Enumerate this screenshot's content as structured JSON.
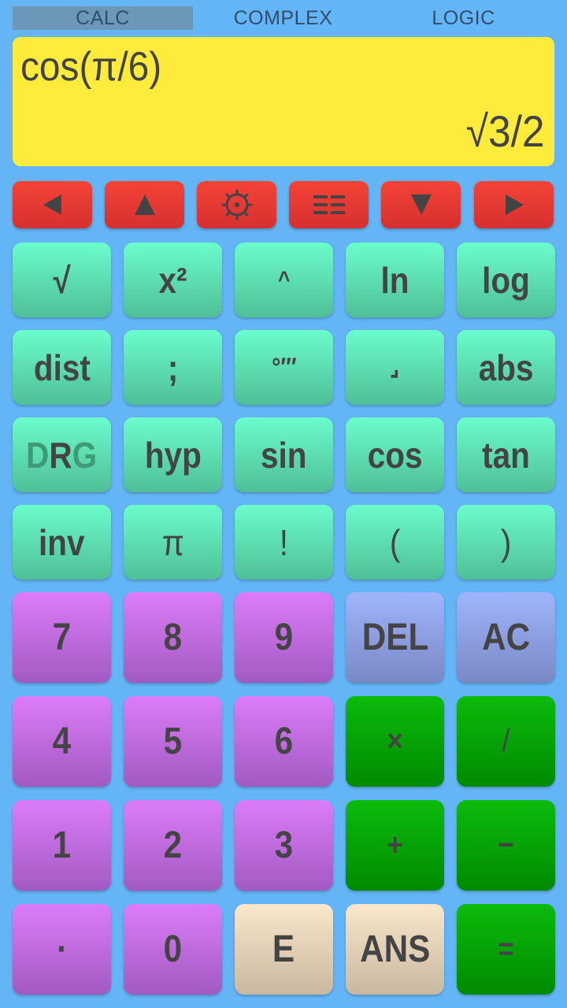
{
  "tabs": [
    {
      "label": "CALC",
      "active": true
    },
    {
      "label": "COMPLEX",
      "active": false
    },
    {
      "label": "LOGIC",
      "active": false
    }
  ],
  "display": {
    "expression": "cos(π/6)",
    "result": "√3/2"
  },
  "nav_buttons": [
    {
      "icon": "arrow-left-icon",
      "label": "cursor left"
    },
    {
      "icon": "arrow-up-icon",
      "label": "history up"
    },
    {
      "icon": "settings-icon",
      "label": "settings"
    },
    {
      "icon": "menu-icon",
      "label": "menu"
    },
    {
      "icon": "arrow-down-icon",
      "label": "history down"
    },
    {
      "icon": "arrow-right-icon",
      "label": "cursor right"
    }
  ],
  "function_keys": [
    [
      "√",
      "x²",
      "^",
      "ln",
      "log"
    ],
    [
      "dist",
      ";",
      "°′″",
      "⌟",
      "abs"
    ],
    [
      "DRG",
      "hyp",
      "sin",
      "cos",
      "tan"
    ],
    [
      "inv",
      "π",
      "!",
      "(",
      ")"
    ]
  ],
  "drg": {
    "d": "D",
    "r": "R",
    "g": "G",
    "active_mode": "R"
  },
  "main_keys": [
    [
      "7",
      "8",
      "9",
      "DEL",
      "AC"
    ],
    [
      "4",
      "5",
      "6",
      "×",
      "/"
    ],
    [
      "1",
      "2",
      "3",
      "+",
      "−"
    ],
    [
      "·",
      "0",
      "E",
      "ANS",
      "="
    ]
  ],
  "colors": {
    "background": "#64b5f6",
    "display": "#ffeb3b",
    "nav": "#f44336",
    "function": "#6bfccc",
    "digit": "#dc7cf8",
    "clear": "#9fb4fc",
    "operator": "#0bbb0b",
    "special": "#fae7cb"
  }
}
